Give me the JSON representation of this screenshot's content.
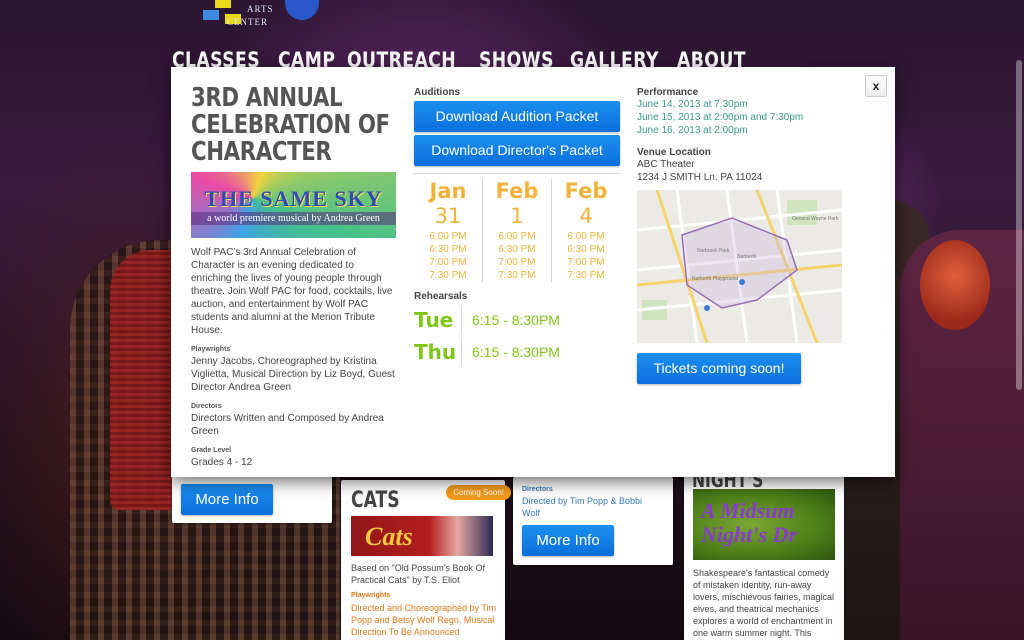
{
  "logo": {
    "word": "ARTS",
    "word2": "CENTER"
  },
  "nav": [
    "CLASSES",
    "CAMP",
    "OUTREACH",
    "SHOWS",
    "GALLERY",
    "ABOUT"
  ],
  "modal": {
    "close_label": "x",
    "title": "3RD ANNUAL CELEBRATION OF CHARACTER",
    "image_title": "THE SAME SKY",
    "image_subtitle": "a world premiere musical by Andrea Green",
    "description": "Wolf PAC's 3rd Annual Celebration of Character is an evening dedicated to enriching the lives of young people through theatre. Join Wolf PAC for food, cocktails, live auction, and entertainment by Wolf PAC students and alumni at the Merion Tribute House.",
    "playwrights_label": "Playwrights",
    "playwrights": "Jenny Jacobs, Choreographed by Kristina Viglietta, Musical Direction by Liz Boyd, Guest Director Andrea Green",
    "directors_label": "Directors",
    "directors": "Directors Written and Composed by Andrea Green",
    "grade_label": "Grade Level",
    "grade": "Grades 4 - 12",
    "auditions": {
      "label": "Auditions",
      "download_audition": "Download Audition Packet",
      "download_director": "Download Director's Packet",
      "dates": [
        {
          "month": "Jan",
          "day": "31",
          "times": [
            "6:00 PM",
            "6:30 PM",
            "7:00 PM",
            "7:30 PM"
          ]
        },
        {
          "month": "Feb",
          "day": "1",
          "times": [
            "6:00 PM",
            "6:30 PM",
            "7:00 PM",
            "7:30 PM"
          ]
        },
        {
          "month": "Feb",
          "day": "4",
          "times": [
            "6:00 PM",
            "6:30 PM",
            "7:00 PM",
            "7:30 PM"
          ]
        }
      ]
    },
    "rehearsals": {
      "label": "Rehearsals",
      "rows": [
        {
          "day": "Tue",
          "time": "6:15 - 8:30PM"
        },
        {
          "day": "Thu",
          "time": "6:15 - 8:30PM"
        }
      ]
    },
    "performance": {
      "label": "Performance",
      "dates": [
        "June 14, 2013 at 7:30pm",
        "June 15, 2013 at 2:00pm and 7:30pm",
        "June 16, 2013 at 2:00pm"
      ]
    },
    "venue": {
      "label": "Venue Location",
      "name": "ABC Theater",
      "address": "1234 J SMITH Ln. PA 11024"
    },
    "tickets_label": "Tickets coming soon!"
  },
  "cards": {
    "card1_button": "More Info",
    "cats": {
      "title": "CATS",
      "badge": "Coming Soon!",
      "image_text": "Cats",
      "desc": "Based on \"Old Possum's Book Of Practical Cats\" by T.S. Eliot",
      "playwrights_label": "Playwrights",
      "playwrights": "Directed and Choreographed by Tim Popp and Betsy Wolf Regn, Musical Direction To Be Announced"
    },
    "card3": {
      "directors_label": "Directors",
      "directors": "Directed by Tim Popp & Bobbi Wolf",
      "button": "More Info"
    },
    "midsummer": {
      "title": "NIGHT'S DREAM",
      "image_text": "A Midsum Night's Dr",
      "desc": "Shakespeare's fantastical comedy of mistaken identity, run-away lovers, mischievous fairies, magical elves, and theatrical mechanics explores a world of enchantment in one warm summer night. This production is recommended for audiences of all"
    }
  }
}
